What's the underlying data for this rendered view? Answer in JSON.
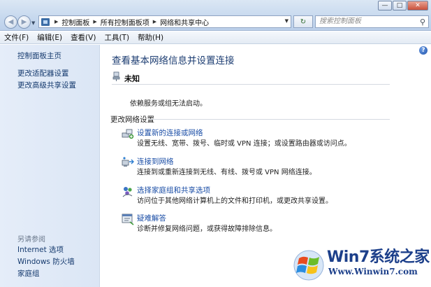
{
  "window": {
    "minimize_glyph": "—",
    "maximize_glyph": "□",
    "close_glyph": "✕"
  },
  "address": {
    "crumbs": [
      "控制面板",
      "所有控制面板项",
      "网络和共享中心"
    ],
    "refresh_glyph": "↻"
  },
  "search": {
    "placeholder": "搜索控制面板"
  },
  "menu": [
    "文件(F)",
    "编辑(E)",
    "查看(V)",
    "工具(T)",
    "帮助(H)"
  ],
  "sidebar": {
    "home": "控制面板主页",
    "links": [
      "更改适配器设置",
      "更改高级共享设置"
    ],
    "see_also_header": "另请参阅",
    "see_also": [
      "Internet 选项",
      "Windows 防火墙",
      "家庭组"
    ]
  },
  "main": {
    "title": "查看基本网络信息并设置连接",
    "network_name": "未知",
    "status": "依赖服务或组无法启动。",
    "section_label": "更改网络设置",
    "tasks": [
      {
        "icon": "new-connection-icon",
        "label": "设置新的连接或网络",
        "desc": "设置无线、宽带、拨号、临时或 VPN 连接；或设置路由器或访问点。"
      },
      {
        "icon": "connect-network-icon",
        "label": "连接到网络",
        "desc": "连接到或重新连接到无线、有线、拨号或 VPN 网络连接。"
      },
      {
        "icon": "homegroup-icon",
        "label": "选择家庭组和共享选项",
        "desc": "访问位于其他网络计算机上的文件和打印机，或更改共享设置。"
      },
      {
        "icon": "troubleshoot-icon",
        "label": "疑难解答",
        "desc": "诊断并修复网络问题，或获得故障排除信息。"
      }
    ]
  },
  "watermark": {
    "title": "Win7系统之家",
    "url": "Www.Winwin7.com"
  },
  "colors": {
    "link": "#1b4ea6",
    "title": "#1c3d72",
    "sidebar_bg": "#e5edf9"
  }
}
